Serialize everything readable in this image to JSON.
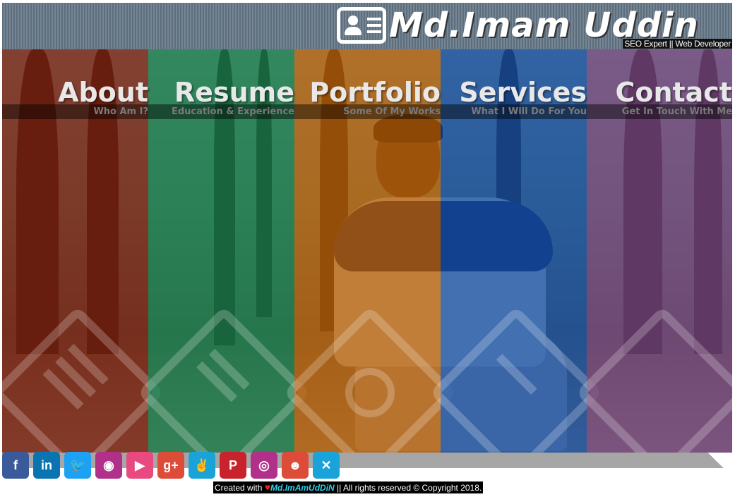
{
  "header": {
    "site_title": "Md.Imam Uddin",
    "tagline": "SEO Expert || Web Developer",
    "logo_icon": "id-card-icon"
  },
  "panels": [
    {
      "title": "About",
      "subtitle": "Who Am I?",
      "color": "#7a1a0a",
      "icon": "document-icon"
    },
    {
      "title": "Resume",
      "subtitle": "Education & Experience",
      "color": "#0b7d4a",
      "icon": "resume-icon"
    },
    {
      "title": "Portfolio",
      "subtitle": "Some Of My Works",
      "color": "#b85d00",
      "icon": "camera-icon"
    },
    {
      "title": "Services",
      "subtitle": "What I Will Do For You",
      "color": "#0a4aa6",
      "icon": "tools-icon"
    },
    {
      "title": "Contact",
      "subtitle": "Get In Touch With Me",
      "color": "#6e3f80",
      "icon": "envelope-icon"
    }
  ],
  "social": [
    {
      "icon": "facebook-icon",
      "glyph": "f",
      "color": "#3b5a9a"
    },
    {
      "icon": "linkedin-icon",
      "glyph": "in",
      "color": "#0a73b1"
    },
    {
      "icon": "twitter-icon",
      "glyph": "🐦",
      "color": "#1da1f2"
    },
    {
      "icon": "github-icon",
      "glyph": "◉",
      "color": "#b0308a"
    },
    {
      "icon": "youtube-icon",
      "glyph": "▶",
      "color": "#e84a7f"
    },
    {
      "icon": "google-plus-icon",
      "glyph": "g+",
      "color": "#dd4b39"
    },
    {
      "icon": "yahoo-icon",
      "glyph": "✌",
      "color": "#1aa3d9"
    },
    {
      "icon": "pinterest-icon",
      "glyph": "P",
      "color": "#c8232c"
    },
    {
      "icon": "instagram-icon",
      "glyph": "◎",
      "color": "#b0308a"
    },
    {
      "icon": "reddit-icon",
      "glyph": "☻",
      "color": "#dd4b39"
    },
    {
      "icon": "xing-icon",
      "glyph": "✕",
      "color": "#1aa3d9"
    }
  ],
  "footer": {
    "prefix": "Created with",
    "author": "Md.ImAmUdDiN",
    "suffix": "|| All rights reserved © Copyright 2018."
  }
}
